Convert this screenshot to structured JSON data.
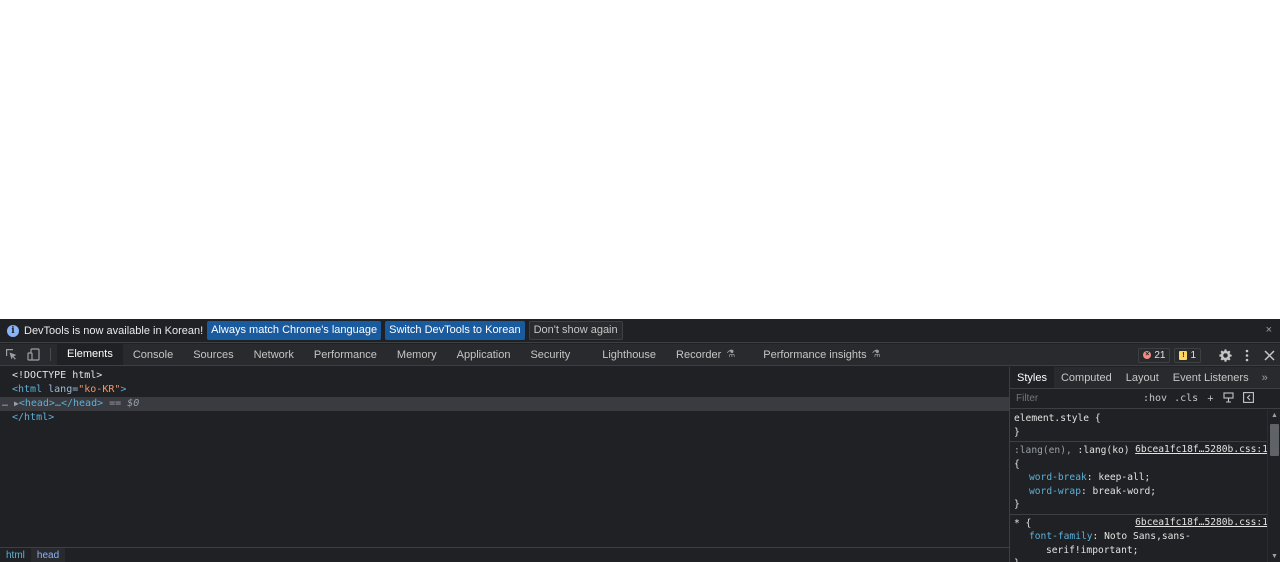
{
  "infobar": {
    "message": "DevTools is now available in Korean!",
    "btn_match": "Always match Chrome's language",
    "btn_switch": "Switch DevTools to Korean",
    "btn_dismiss": "Don't show again",
    "close": "×"
  },
  "tabs": [
    {
      "label": "Elements",
      "active": true
    },
    {
      "label": "Console"
    },
    {
      "label": "Sources"
    },
    {
      "label": "Network"
    },
    {
      "label": "Performance"
    },
    {
      "label": "Memory"
    },
    {
      "label": "Application"
    },
    {
      "label": "Security"
    },
    {
      "label": "Lighthouse"
    },
    {
      "label": "Recorder"
    },
    {
      "label": "Performance insights"
    }
  ],
  "status": {
    "errors": "21",
    "warnings": "1"
  },
  "dom": {
    "doctype": "<!DOCTYPE html>",
    "html_open_tag": "<html",
    "html_attr_name": " lang=",
    "html_attr_value": "\"ko-KR\"",
    "html_open_end": ">",
    "head_collapsed": "<head>…</head>",
    "selected_marker": " == ",
    "selected_var": "$0",
    "html_close": "</html>",
    "dots": "…"
  },
  "breadcrumbs": [
    "html",
    "head"
  ],
  "sidebar": {
    "tabs": [
      "Styles",
      "Computed",
      "Layout",
      "Event Listeners"
    ],
    "more": "»",
    "filter_placeholder": "Filter",
    "hov": ":hov",
    "cls": ".cls"
  },
  "rules": {
    "r1": {
      "selector": "element.style {",
      "close": "}"
    },
    "r2": {
      "selector_dim": ":lang(en), ",
      "selector": ":lang(ko)",
      "source": "6bcea1fc18f…5280b.css:1",
      "open": "{",
      "p1_name": "word-break",
      "p1_value": ": keep-all;",
      "p2_name": "word-wrap",
      "p2_value": ": break-word;",
      "close": "}"
    },
    "r3": {
      "selector": "* {",
      "source": "6bcea1fc18f…5280b.css:1",
      "p1_name": "font-family",
      "p1_value": ": Noto Sans,sans-",
      "p1_cont": "serif!important;",
      "close": "}"
    }
  },
  "colors": {
    "panel_bg": "#202124",
    "toolbar_bg": "#292a2d",
    "tag_blue": "#5db0d7",
    "attr_value_orange": "#f29766",
    "button_blue": "#1a5a9e"
  }
}
